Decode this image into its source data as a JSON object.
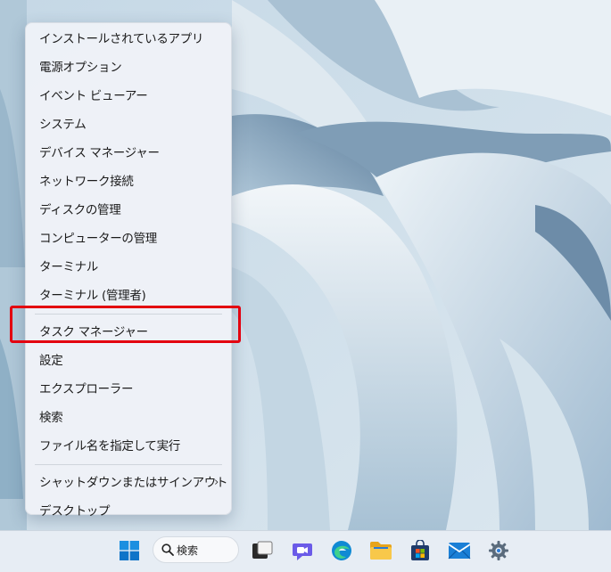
{
  "menu": {
    "items": [
      {
        "label": "インストールされているアプリ"
      },
      {
        "label": "電源オプション"
      },
      {
        "label": "イベント ビューアー"
      },
      {
        "label": "システム"
      },
      {
        "label": "デバイス マネージャー"
      },
      {
        "label": "ネットワーク接続"
      },
      {
        "label": "ディスクの管理"
      },
      {
        "label": "コンピューターの管理"
      },
      {
        "label": "ターミナル"
      },
      {
        "label": "ターミナル (管理者)"
      }
    ],
    "items2": [
      {
        "label": "タスク マネージャー"
      },
      {
        "label": "設定"
      },
      {
        "label": "エクスプローラー"
      },
      {
        "label": "検索"
      },
      {
        "label": "ファイル名を指定して実行"
      }
    ],
    "items3": [
      {
        "label": "シャットダウンまたはサインアウト",
        "chevron": "›"
      },
      {
        "label": "デスクトップ"
      }
    ]
  },
  "highlight": {
    "target": "タスク マネージャー",
    "color": "#e3000f"
  },
  "taskbar": {
    "search_label": "検索",
    "icons": [
      "start-icon",
      "search-icon",
      "task-view-icon",
      "teams-chat-icon",
      "edge-icon",
      "file-explorer-icon",
      "store-icon",
      "mail-icon",
      "settings-gear-icon"
    ]
  },
  "colors": {
    "accent": "#0067c0",
    "wallpaper": "#b9cfdd"
  }
}
